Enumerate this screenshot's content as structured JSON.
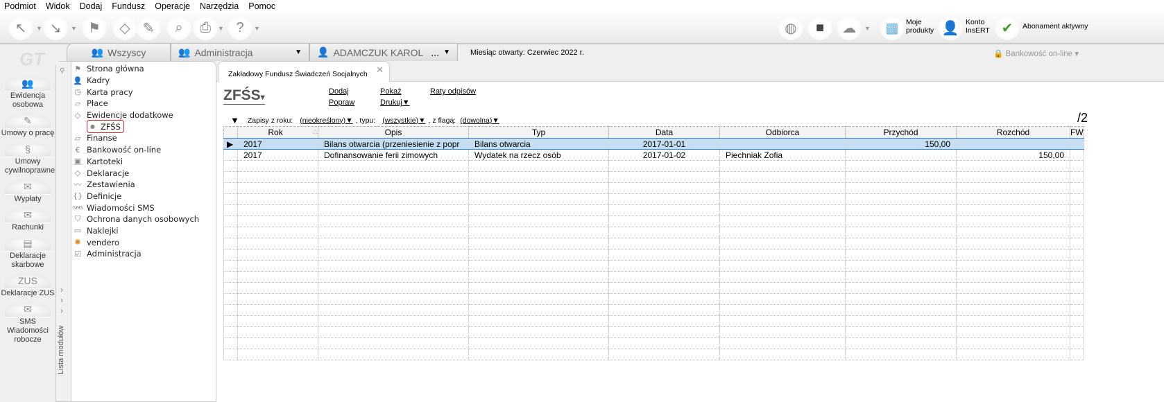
{
  "menu": [
    "Podmiot",
    "Widok",
    "Dodaj",
    "Fundusz",
    "Operacje",
    "Narzędzia",
    "Pomoc"
  ],
  "toolbar_right": {
    "products": "Moje produkty",
    "account": "Konto InsERT",
    "subscription": "Abonament aktywny"
  },
  "tabs": {
    "all": "Wszyscy",
    "group": "Administracja",
    "person": "ADAMCZUK KAROL",
    "person_more": "..."
  },
  "month_label": "Miesiąc otwarty: Czerwiec 2022 r.",
  "banking": "Bankowość on-line",
  "left_modules": [
    "Ewidencja osobowa",
    "Umowy o pracę",
    "Umowy cywilnoprawne",
    "Wypłaty",
    "Rachunki",
    "Deklaracje skarbowe",
    "Deklaracje ZUS",
    "SMS Wiadomości robocze"
  ],
  "module_list_label": "Lista modułów",
  "modules": [
    "Strona główna",
    "Kadry",
    "Karta pracy",
    "Płace",
    "Ewidencje dodatkowe",
    "ZFŚS",
    "Finanse",
    "Bankowość on-line",
    "Kartoteki",
    "Deklaracje",
    "Zestawienia",
    "Definicje",
    "Wiadomości SMS",
    "Ochrona danych osobowych",
    "Naklejki",
    "vendero",
    "Administracja"
  ],
  "doc_tab": "Zakładowy Fundusz Świadczeń Socjalnych",
  "title": "ZFŚS",
  "actions": {
    "add": "Dodaj",
    "edit": "Popraw",
    "show": "Pokaż",
    "print": "Drukuj",
    "installments": "Raty odpisów"
  },
  "filter": {
    "year_label": "Zapisy z roku:",
    "year": "(nieokreślony)",
    "type_label": ", typu:",
    "type": "(wszystkie)",
    "flag_label": ", z flagą:",
    "flag": "(dowolna)"
  },
  "count": "/2",
  "columns": [
    "Rok",
    "Opis",
    "Typ",
    "Data",
    "Odbiorca",
    "Przychód",
    "Rozchód",
    "FW"
  ],
  "rows": [
    [
      "2017",
      "Bilans otwarcia (przeniesienie z popr",
      "Bilans otwarcia",
      "2017-01-01",
      "",
      "150,00",
      "",
      ""
    ],
    [
      "2017",
      "Dofinansowanie ferii zimowych",
      "Wydatek na rzecz osób",
      "2017-01-02",
      "Piechniak Zofia",
      "",
      "150,00",
      ""
    ]
  ]
}
